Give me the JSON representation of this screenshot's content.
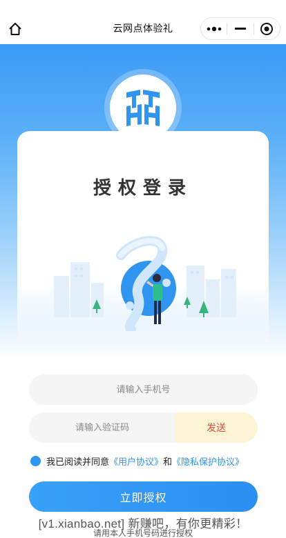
{
  "nav": {
    "title": "云网点体验礼",
    "home_icon": "home-icon",
    "more_icon": "more-dots-icon",
    "minimize_icon": "minimize-icon",
    "close_icon": "target-close-icon"
  },
  "hero": {
    "logo_icon": "hh-logo-icon",
    "title": "授权登录",
    "illustration": "person-with-document-illustration"
  },
  "form": {
    "phone_placeholder": "请输入手机号",
    "code_placeholder": "请输入验证码",
    "send_label": "发送",
    "agree_text": "我已阅读并同意",
    "user_agreement": "《用户协议》",
    "and_text": "和",
    "privacy_agreement": "《隐私保护协议》",
    "submit_label": "立即授权"
  },
  "footer": {
    "watermark": "[v1.xianbao.net] 新赚吧，有你更精彩！",
    "hint": "请用本人手机号码进行授权"
  },
  "colors": {
    "primary": "#2f95f0",
    "send_bg": "#fdf4d6",
    "send_text": "#e04a3f"
  }
}
